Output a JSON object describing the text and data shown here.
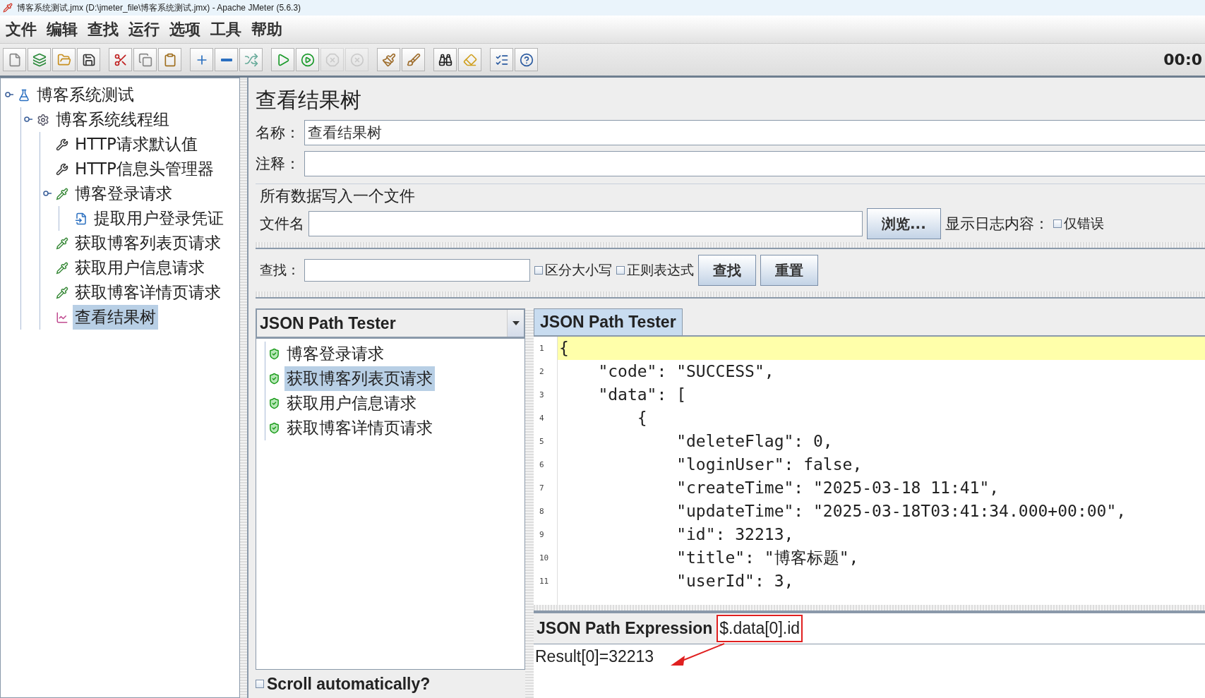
{
  "window": {
    "title": "博客系统测试.jmx (D:\\jmeter_file\\博客系统测试.jmx) - Apache JMeter (5.6.3)"
  },
  "menu": [
    "文件",
    "编辑",
    "查找",
    "运行",
    "选项",
    "工具",
    "帮助"
  ],
  "toolbar": {
    "groups": [
      [
        {
          "disabled": false
        },
        {
          "disabled": false
        },
        {
          "disabled": false
        },
        {
          "disabled": false
        }
      ],
      [
        {
          "disabled": false
        },
        {
          "disabled": false
        },
        {
          "disabled": false
        }
      ],
      [
        {
          "disabled": false
        },
        {
          "disabled": false
        },
        {
          "disabled": false
        }
      ],
      [
        {
          "disabled": false
        },
        {
          "disabled": false
        },
        {
          "disabled": true
        },
        {
          "disabled": true
        }
      ],
      [
        {
          "disabled": false
        },
        {
          "disabled": false
        }
      ],
      [
        {
          "disabled": false
        },
        {
          "disabled": false
        }
      ],
      [
        {
          "disabled": false
        },
        {
          "disabled": false
        }
      ]
    ],
    "timer": "00:0"
  },
  "test_tree": [
    {
      "label": "博客系统测试",
      "kind": "plan",
      "expanded": true,
      "selected": false,
      "children": [
        {
          "label": "博客系统线程组",
          "kind": "threads",
          "expanded": true,
          "selected": false,
          "children": [
            {
              "label": "HTTP请求默认值",
              "kind": "config",
              "selected": false
            },
            {
              "label": "HTTP信息头管理器",
              "kind": "config",
              "selected": false
            },
            {
              "label": "博客登录请求",
              "kind": "sampler",
              "expanded": true,
              "selected": false,
              "children": [
                {
                  "label": "提取用户登录凭证",
                  "kind": "extractor",
                  "selected": false
                }
              ]
            },
            {
              "label": "获取博客列表页请求",
              "kind": "sampler",
              "selected": false
            },
            {
              "label": "获取用户信息请求",
              "kind": "sampler",
              "selected": false
            },
            {
              "label": "获取博客详情页请求",
              "kind": "sampler",
              "selected": false
            },
            {
              "label": "查看结果树",
              "kind": "listener",
              "selected": true
            }
          ]
        }
      ]
    }
  ],
  "panel": {
    "title": "查看结果树",
    "name": {
      "label": "名称：",
      "value": "查看结果树"
    },
    "comment": {
      "label": "注释："
    },
    "file_section": {
      "title": "所有数据写入一个文件",
      "label": "文件名",
      "browse": "浏览...",
      "log_label": "显示日志内容：",
      "errors_only": {
        "label": "仅错误",
        "checked": false
      }
    },
    "search": {
      "label": "查找：",
      "case_sensitive": {
        "label": "区分大小写",
        "checked": false
      },
      "regex": {
        "label": "正则表达式",
        "checked": false
      },
      "find": "查找",
      "reset": "重置"
    },
    "renderer": {
      "value": "JSON Path Tester"
    },
    "results": [
      {
        "label": "博客登录请求",
        "kind": "success",
        "selected": false
      },
      {
        "label": "获取博客列表页请求",
        "kind": "success",
        "selected": true
      },
      {
        "label": "获取用户信息请求",
        "kind": "success",
        "selected": false
      },
      {
        "label": "获取博客详情页请求",
        "kind": "success",
        "selected": false
      }
    ],
    "scroll_auto": {
      "label": "Scroll automatically?",
      "checked": false
    },
    "tab": {
      "label": "JSON Path Tester",
      "selected": true
    },
    "code_lines": [
      {
        "number": "1",
        "text": "{",
        "current": true
      },
      {
        "number": "2",
        "text": "    \"code\": \"SUCCESS\",",
        "current": false
      },
      {
        "number": "3",
        "text": "    \"data\": [",
        "current": false
      },
      {
        "number": "4",
        "text": "        {",
        "current": false
      },
      {
        "number": "5",
        "text": "            \"deleteFlag\": 0,",
        "current": false
      },
      {
        "number": "6",
        "text": "            \"loginUser\": false,",
        "current": false
      },
      {
        "number": "7",
        "text": "            \"createTime\": \"2025-03-18 11:41\",",
        "current": false
      },
      {
        "number": "8",
        "text": "            \"updateTime\": \"2025-03-18T03:41:34.000+00:00\",",
        "current": false
      },
      {
        "number": "9",
        "text": "            \"id\": 32213,",
        "current": false
      },
      {
        "number": "10",
        "text": "            \"title\": \"博客标题\",",
        "current": false
      },
      {
        "number": "11",
        "text": "            \"userId\": 3,",
        "current": false
      }
    ],
    "expression": {
      "label": "JSON Path Expression",
      "value": "$.data[0].id"
    },
    "result": "Result[0]=32213"
  }
}
